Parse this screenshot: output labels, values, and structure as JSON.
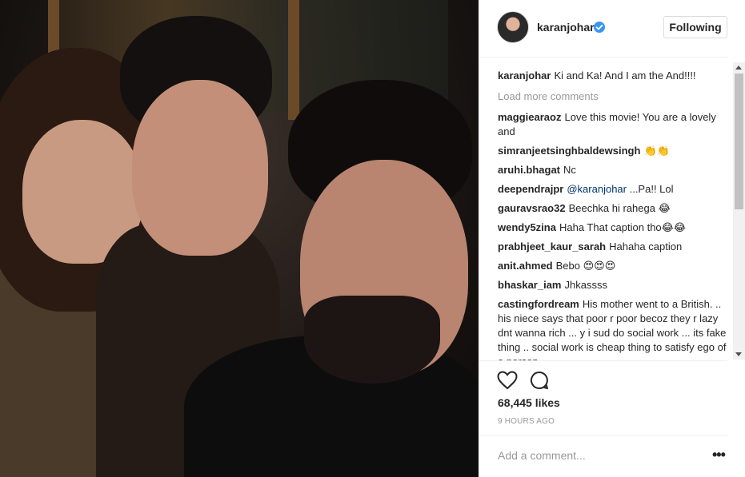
{
  "post": {
    "author": "karanjohar",
    "verified_icon": "verified-badge-icon",
    "follow_label": "Following",
    "caption_text": "Ki and Ka! And I am the And!!!!",
    "load_more": "Load more comments",
    "likes": "68,445 likes",
    "time_ago": "9 HOURS AGO",
    "add_comment_placeholder": "Add a comment...",
    "more_label": "•••"
  },
  "comments": [
    {
      "user": "maggiearaoz",
      "text": "Love this movie! You are a lovely and"
    },
    {
      "user": "simranjeetsinghbaldewsingh",
      "text": "👏👏"
    },
    {
      "user": "aruhi.bhagat",
      "text": "Nc"
    },
    {
      "user": "deependrajpr",
      "mention": "@karanjohar",
      "text": " ...Pa!! Lol"
    },
    {
      "user": "gauravsrao32",
      "text": "Beechka hi rahega 😂"
    },
    {
      "user": "wendy5zina",
      "text": "Haha That caption tho😂😂"
    },
    {
      "user": "prabhjeet_kaur_sarah",
      "text": "Hahaha caption"
    },
    {
      "user": "anit.ahmed",
      "text": "Bebo 😍😍😍"
    },
    {
      "user": "bhaskar_iam",
      "text": "Jhkassss"
    },
    {
      "user": "castingfordream",
      "text": "His mother went to a British. .. his niece says that poor r poor becoz they r lazy dnt wanna rich ... y i sud do social work ... its fake thing .. social work is cheap thing to satisfy ego of a person"
    }
  ],
  "colors": {
    "accent": "#3897f0",
    "text": "#262626",
    "muted": "#999999",
    "border": "#efefef"
  },
  "icons": {
    "like": "heart-outline-icon",
    "comment": "speech-bubble-icon",
    "more": "ellipsis-icon"
  }
}
